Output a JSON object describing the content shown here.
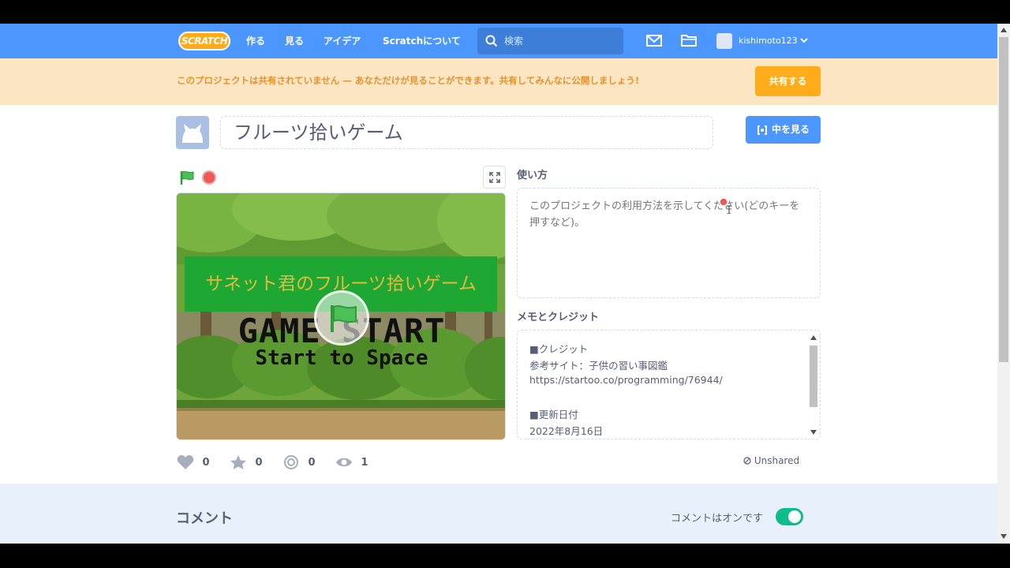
{
  "navbar": {
    "logo": "SCRATCH",
    "links": [
      "作る",
      "見る",
      "アイデア",
      "Scratchについて"
    ],
    "search_placeholder": "検索",
    "username": "kishimoto123"
  },
  "banner": {
    "text": "このプロジェクトは共有されていません — あなただけが見ることができます。共有してみんなに公開しましょう!",
    "share_label": "共有する"
  },
  "project": {
    "title": "フルーツ拾いゲーム",
    "see_inside_label": "中を見る"
  },
  "stage": {
    "title_text": "サネット君のフルーツ拾いゲーム",
    "game_start": "GAME START",
    "start_space": "Start to Space"
  },
  "stats": {
    "loves": "0",
    "favorites": "0",
    "remixes": "0",
    "views": "1",
    "status": "Unshared"
  },
  "instructions": {
    "label": "使い方",
    "placeholder": "このプロジェクトの利用方法を示してください(どのキーを押すなど)。"
  },
  "notes": {
    "label": "メモとクレジット",
    "lines": [
      "■クレジット",
      "参考サイト：子供の習い事図鑑",
      "https://startoo.co/programming/76944/",
      "",
      "■更新日付",
      "2022年8月16日"
    ]
  },
  "comments": {
    "title": "コメント",
    "status": "コメントはオンです"
  },
  "colors": {
    "nav_blue": "#4c97ff",
    "banner_bg": "#fce5c3",
    "banner_text": "#e5932c",
    "share_orange": "#ffab1a",
    "toggle_green": "#0fbd8c"
  }
}
